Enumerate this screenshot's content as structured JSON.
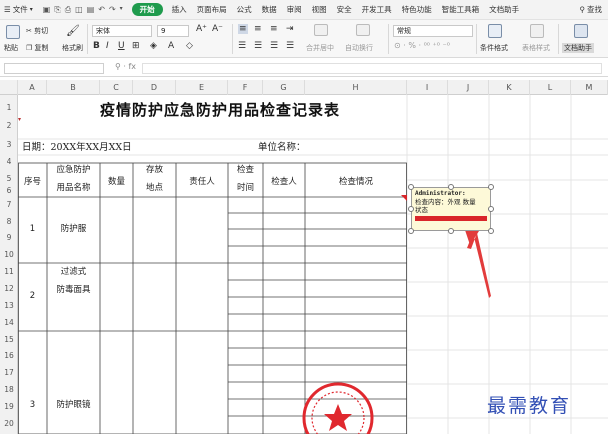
{
  "menu": {
    "file_label": "文件",
    "tabs": [
      "开始",
      "插入",
      "页面布局",
      "公式",
      "数据",
      "审阅",
      "视图",
      "安全",
      "开发工具",
      "特色功能",
      "智能工具箱",
      "文档助手"
    ],
    "active_tab": "开始",
    "search_label": "查找"
  },
  "ribbon": {
    "paste": "粘贴",
    "cut": "剪切",
    "copy": "复制",
    "format_painter": "格式刷",
    "font_name": "宋体",
    "font_size": "9",
    "merge_center": "合并居中",
    "wrap_text": "自动换行",
    "number_format": "常规",
    "conditional_format": "条件格式",
    "cell_style": "表格样式",
    "doc_assistant": "文档助手"
  },
  "sheet": {
    "columns": [
      "A",
      "B",
      "C",
      "D",
      "E",
      "F",
      "G",
      "H",
      "I",
      "J",
      "K",
      "L",
      "M"
    ],
    "rows": [
      "1",
      "2",
      "3",
      "4",
      "5",
      "6",
      "7",
      "8",
      "9",
      "10",
      "11",
      "12",
      "13",
      "14",
      "15",
      "16",
      "17",
      "18",
      "19",
      "20"
    ],
    "title": "疫情防护应急防护用品检查记录表",
    "date_label": "日期：20XX年XX月XX日",
    "unit_label": "单位名称：",
    "headers": {
      "seq": "序号",
      "item_name_1": "应急防护",
      "item_name_2": "用品名称",
      "quantity": "数量",
      "location_1": "存放",
      "location_2": "地点",
      "responsible": "责任人",
      "check_time_1": "检查",
      "check_time_2": "时间",
      "inspector": "检查人",
      "status": "检查情况"
    },
    "rows_data": [
      {
        "seq": "1",
        "name": "防护服"
      },
      {
        "seq": "2",
        "name_1": "过滤式",
        "name_2": "防毒面具"
      },
      {
        "seq": "3",
        "name": "防护眼镜"
      }
    ]
  },
  "comment": {
    "author": "Administrator:",
    "text_1": "检查内容：外观 数量",
    "text_2": "状态"
  },
  "watermark": "最需教育",
  "colors": {
    "active_tab": "#1f9b4d",
    "arrow": "#e23b3b",
    "stamp": "#e0282e",
    "watermark": "#3350b5"
  }
}
